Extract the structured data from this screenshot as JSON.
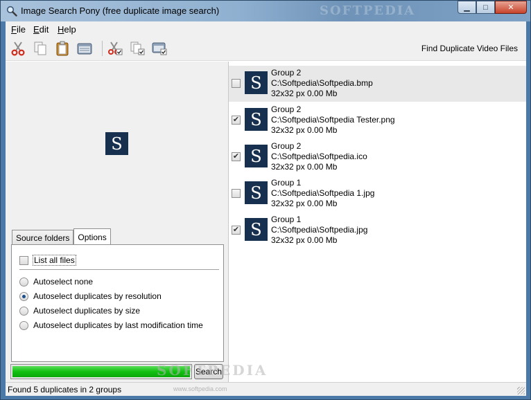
{
  "window": {
    "title": "Image Search Pony (free duplicate image search)",
    "watermark": "SOFTPEDIA",
    "minimize_glyph": "▁",
    "maximize_glyph": "□",
    "close_glyph": "✕"
  },
  "menu": {
    "file": {
      "key": "F",
      "rest": "ile"
    },
    "edit": {
      "key": "E",
      "rest": "dit"
    },
    "help": {
      "key": "H",
      "rest": "elp"
    }
  },
  "toolbar": {
    "buttons": [
      "cut-icon",
      "copy-icon",
      "paste-icon",
      "select-all-icon",
      "cut-checked-icon",
      "copy-checked-icon",
      "select-checked-icon"
    ],
    "find_video_label": "Find Duplicate Video Files"
  },
  "preview": {
    "glyph": "S"
  },
  "tabs": [
    {
      "label": "Source folders",
      "active": false
    },
    {
      "label": "Options",
      "active": true
    }
  ],
  "options": {
    "list_all_files_label": "List all files",
    "list_all_files_checked": false,
    "radios": [
      {
        "label": "Autoselect none",
        "selected": false
      },
      {
        "label": "Autoselect duplicates by resolution",
        "selected": true
      },
      {
        "label": "Autoselect duplicates by size",
        "selected": false
      },
      {
        "label": "Autoselect duplicates by last modification time",
        "selected": false
      }
    ]
  },
  "progress": {
    "fraction": 1.0
  },
  "search_button_label": "Search",
  "results": [
    {
      "group": "Group 2",
      "path": "C:\\Softpedia\\Softpedia.bmp",
      "info": "32x32 px 0.00 Mb",
      "checked": false,
      "selected": true,
      "glyph": "S"
    },
    {
      "group": "Group 2",
      "path": "C:\\Softpedia\\Softpedia Tester.png",
      "info": "32x32 px 0.00 Mb",
      "checked": true,
      "selected": false,
      "glyph": "S"
    },
    {
      "group": "Group 2",
      "path": "C:\\Softpedia\\Softpedia.ico",
      "info": "32x32 px 0.00 Mb",
      "checked": true,
      "selected": false,
      "glyph": "S"
    },
    {
      "group": "Group 1",
      "path": "C:\\Softpedia\\Softpedia 1.jpg",
      "info": "32x32 px 0.00 Mb",
      "checked": false,
      "selected": false,
      "glyph": "S"
    },
    {
      "group": "Group 1",
      "path": "C:\\Softpedia\\Softpedia.jpg",
      "info": "32x32 px 0.00 Mb",
      "checked": true,
      "selected": false,
      "glyph": "S"
    }
  ],
  "status": {
    "text": "Found 5 duplicates in 2 groups",
    "watermark": "SOFTPEDIA",
    "watermark_url": "www.softpedia.com"
  },
  "colors": {
    "accent_title": "#8fb0d0",
    "progress_green": "#11c011",
    "thumb_navy": "#18304f"
  }
}
